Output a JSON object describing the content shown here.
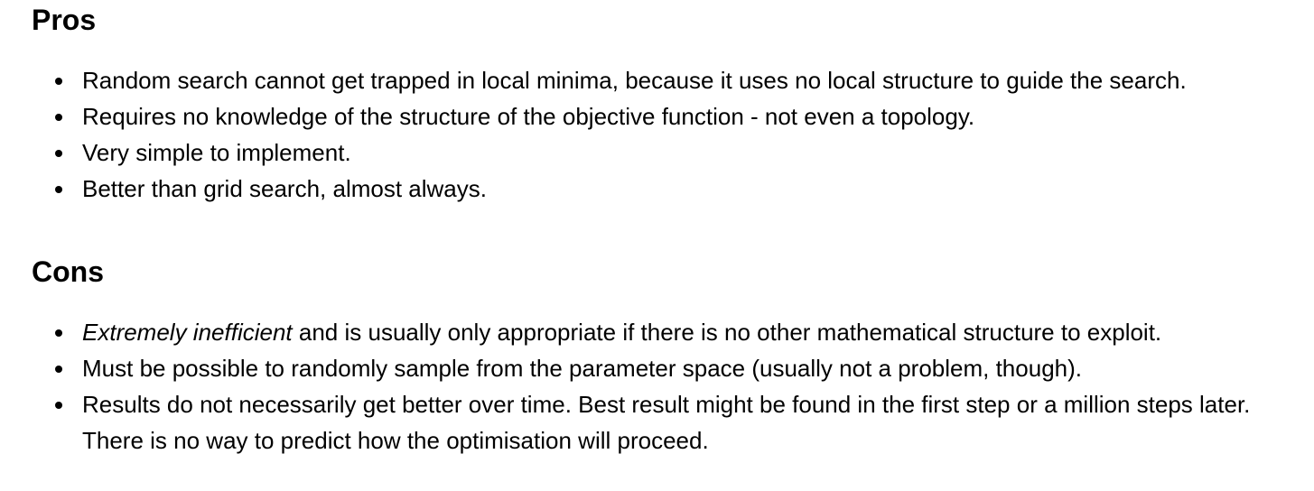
{
  "pros": {
    "heading": "Pros",
    "items": [
      "Random search cannot get trapped in local minima, because it uses no local structure to guide the search.",
      "Requires no knowledge of the structure of the objective function - not even a topology.",
      "Very simple to implement.",
      "Better than grid search, almost always."
    ]
  },
  "cons": {
    "heading": "Cons",
    "items": [
      {
        "emphasis": "Extremely inefficient",
        "text": " and is usually only appropriate if there is no other mathematical structure to exploit."
      },
      "Must be possible to randomly sample from the parameter space (usually not a problem, though).",
      "Results do not necessarily get better over time. Best result might be found in the first step or a million steps later. There is no way to predict how the optimisation will proceed."
    ]
  }
}
